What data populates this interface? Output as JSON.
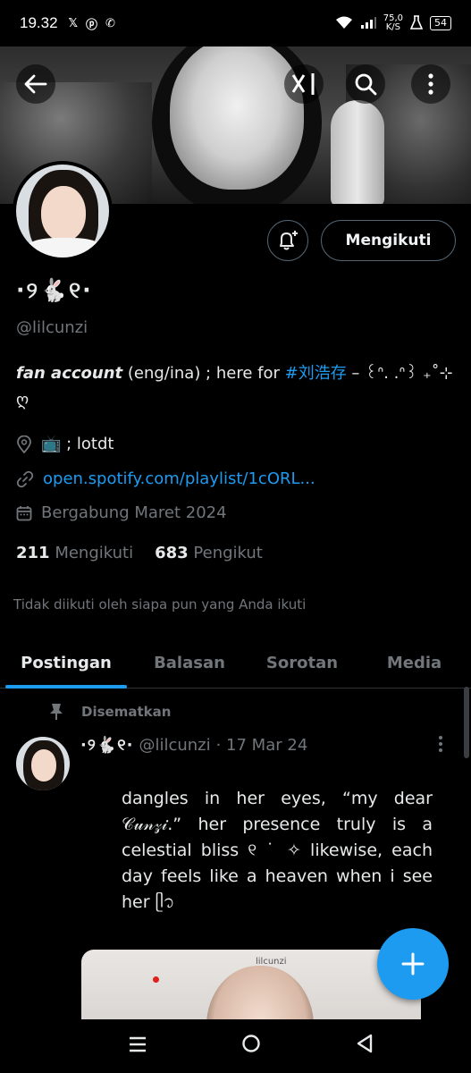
{
  "status_bar": {
    "time": "19.32",
    "app_icons": [
      "x-icon",
      "pinterest-icon",
      "whatsapp-icon"
    ],
    "net_speed": "75,0",
    "net_speed_unit": "K/S",
    "battery": "54"
  },
  "banner": {
    "back_icon": "back-arrow-icon",
    "grok_icon": "grok-icon",
    "search_icon": "search-icon",
    "more_icon": "more-vertical-icon"
  },
  "profile": {
    "display_name": "·୨🐇୧·",
    "handle": "@lilcunzi",
    "follow_label": "Mengikuti",
    "bio": {
      "emphasis": "fan account",
      "middle": " (eng/ina) ; here for ",
      "hashtag": "#刘浩存",
      "tail": " – ꒰ᐢ. .ᐢ꒱ ₊˚⊹ ღ"
    },
    "location": "📺 ; lotdt",
    "link": "open.spotify.com/playlist/1cORL...",
    "joined": "Bergabung Maret 2024",
    "following_count": "211",
    "following_label": "Mengikuti",
    "followers_count": "683",
    "followers_label": "Pengikut",
    "not_followed_text": "Tidak diikuti oleh siapa pun yang Anda ikuti"
  },
  "tabs": [
    {
      "label": "Postingan",
      "active": true
    },
    {
      "label": "Balasan",
      "active": false
    },
    {
      "label": "Sorotan",
      "active": false
    },
    {
      "label": "Media",
      "active": false
    }
  ],
  "pinned_tweet": {
    "pinned_label": "Disematkan",
    "name": "·୨🐇୧·",
    "handle": "@lilcunzi",
    "date": "· 17 Mar 24",
    "text": "dangles in her eyes, “my dear 𝒞𝓊𝓃𝓏𝒾.” her presence truly is a celestial bliss ୧ ˙ ✧ likewise, each day feels like a heaven when i see her ᥫ᭡",
    "media_caption": "lilcunzi"
  },
  "fab_icon": "plus-icon",
  "nav": [
    "menu-icon",
    "home-circle-icon",
    "back-triangle-icon"
  ],
  "colors": {
    "accent": "#1d9bf0",
    "text_primary": "#e7e9ea",
    "text_secondary": "#71767b",
    "background": "#000000",
    "border": "#2f3336"
  }
}
